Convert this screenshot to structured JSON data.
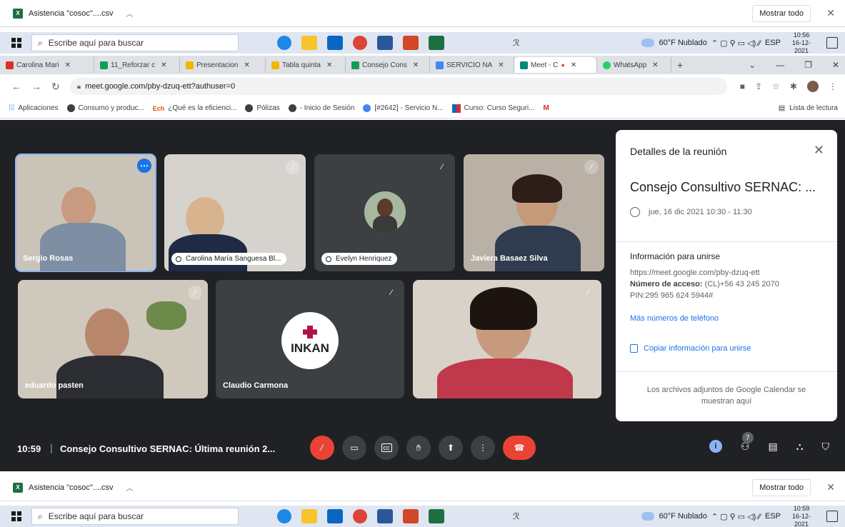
{
  "download_bar": {
    "file": "Asistencia \"cosoc\"....csv",
    "show_all": "Mostrar todo"
  },
  "taskbar_top": {
    "search_placeholder": "Escribe aquí para buscar",
    "weather": "60°F Nublado",
    "lang": "ESP",
    "time": "10:56",
    "date": "16-12-2021"
  },
  "taskbar_bottom": {
    "search_placeholder": "Escribe aquí para buscar",
    "weather": "60°F Nublado",
    "lang": "ESP",
    "time": "10:59",
    "date": "16-12-2021"
  },
  "tabs": [
    {
      "label": "Carolina Mari",
      "color": "#d93025"
    },
    {
      "label": "11_Reforzar c",
      "color": "#0f9d58"
    },
    {
      "label": "Presentacion",
      "color": "#f4b400"
    },
    {
      "label": "Tabla quinta",
      "color": "#f4b400"
    },
    {
      "label": "Consejo Cons",
      "color": "#0f9d58"
    },
    {
      "label": "SERVICIO NA",
      "color": "#4285f4"
    },
    {
      "label": "Meet - C",
      "color": "#00897b"
    },
    {
      "label": "WhatsApp",
      "color": "#25d366"
    }
  ],
  "url": "meet.google.com/pby-dzuq-ett?authuser=0",
  "bookmarks": [
    "Aplicaciones",
    "Consumo y produc...",
    "¿Qué es la eficienci...",
    "Pólizas",
    "- Inicio de Sesión",
    "[#2642] - Servicio N...",
    "Curso: Curso Seguri...",
    "M"
  ],
  "reading_list": "Lista de lectura",
  "participants": {
    "p1": "Sergio Rosas",
    "p2": "Carolina María Sanguesa Bl...",
    "p3": "Evelyn Henriquez",
    "p4": "Javiera Basaez Silva",
    "p5": "eduardo pasten",
    "p6": "Claudio Carmona"
  },
  "inkan_logo": "INKAN",
  "panel": {
    "title": "Detalles de la reunión",
    "meeting_name": "Consejo Consultivo SERNAC: ...",
    "time": "jue, 16 dic 2021 10:30 - 11:30",
    "join_heading": "Información para unirse",
    "link": "https://meet.google.com/pby-dzuq-ett",
    "access_label": "Número de acceso:",
    "access_value": "(CL)+56 43 245 2070",
    "pin": "PIN:295 965 624 5944#",
    "more_phones": "Más números de teléfono",
    "copy_info": "Copiar información para unirse",
    "attachments": "Los archivos adjuntos de Google Calendar se muestran aquí"
  },
  "control_bar": {
    "time": "10:59",
    "meeting": "Consejo Consultivo SERNAC: Última reunión 2...",
    "people_count": "7"
  }
}
